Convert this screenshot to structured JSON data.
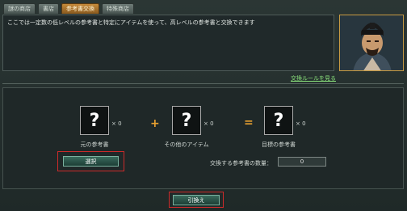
{
  "tabs": [
    {
      "label": "謎の商店",
      "active": false
    },
    {
      "label": "書店",
      "active": false
    },
    {
      "label": "参考書交換",
      "active": true
    },
    {
      "label": "特殊商店",
      "active": false
    }
  ],
  "description": "ここでは一定数の低レベルの参考書と特定にアイテムを使って、高レベルの参考書と交換できます",
  "rules_link": "交換ルールを見る",
  "slots": [
    {
      "symbol": "?",
      "count": "× 0",
      "label": "元の参考書"
    },
    {
      "symbol": "?",
      "count": "× 0",
      "label": "その他のアイテム"
    },
    {
      "symbol": "?",
      "count": "× 0",
      "label": "目標の参考書"
    }
  ],
  "operators": {
    "plus": "+",
    "equals": "="
  },
  "select_button": "選択",
  "quantity": {
    "label": "交換する参考書の数量：",
    "value": "0"
  },
  "exchange_button": "引換え",
  "colors": {
    "active_tab": "#c68a3a",
    "link": "#89e07b",
    "highlight": "#cc2a2a"
  }
}
